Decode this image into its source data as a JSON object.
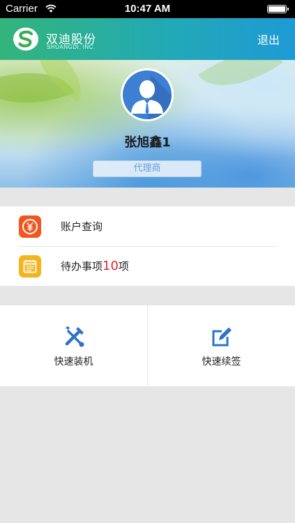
{
  "status_bar": {
    "carrier": "Carrier",
    "time": "10:47 AM"
  },
  "nav": {
    "brand_name": "双迪股份",
    "brand_sub": "SHUANGDI, INC.",
    "logout_label": "退出",
    "accent": "#1e9ad6"
  },
  "profile": {
    "user_name": "张旭鑫1",
    "role": "代理商",
    "avatar_icon": "user-avatar-icon"
  },
  "menu": {
    "account_query": {
      "label": "账户查询",
      "icon": "yuan-icon",
      "icon_color": "#f0561e"
    },
    "todo": {
      "label_prefix": "待办事项",
      "count": "10",
      "label_suffix": "项",
      "icon": "notepad-icon",
      "icon_color": "#f5b31c"
    }
  },
  "quick_actions": {
    "install": {
      "label": "快速装机",
      "icon": "tools-icon"
    },
    "renew": {
      "label": "快速续签",
      "icon": "edit-icon"
    }
  }
}
